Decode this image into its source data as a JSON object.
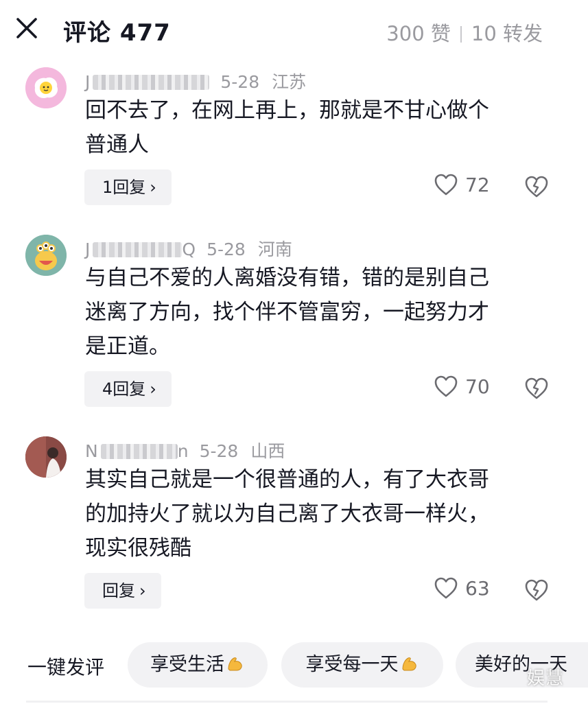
{
  "header": {
    "title": "评论 477",
    "likes": "300 赞",
    "shares": "10 转发"
  },
  "comments": [
    {
      "username_visible": "J",
      "date": "5-28",
      "location": "江苏",
      "text_lines": [
        "回不去了，在网上再上，那就是不甘心做个",
        "普通人"
      ],
      "reply_label": "1回复",
      "like_count": "72",
      "avatar_icon": "fried-egg-avatar"
    },
    {
      "username_visible": "J",
      "username_suffix": "Q",
      "date": "5-28",
      "location": "河南",
      "text_lines": [
        "与自己不爱的人离婚没有错，错的是别自己",
        "迷离了方向，找个伴不管富穷，一起努力才",
        "是正道。"
      ],
      "reply_label": "4回复",
      "like_count": "70",
      "avatar_icon": "monster-avatar"
    },
    {
      "username_visible": "N",
      "username_suffix": "n",
      "date": "5-28",
      "location": "山西",
      "text_lines": [
        "其实自己就是一个很普通的人，有了大衣哥",
        "的加持火了就以为自己离了大衣哥一样火，",
        "现实很残酷"
      ],
      "reply_label": "回复",
      "like_count": "63",
      "avatar_icon": "photo-avatar"
    }
  ],
  "quick_comment": {
    "label": "一键发评",
    "chips": [
      "享受生活",
      "享受每一天",
      "美好的一天"
    ]
  },
  "watermark": "娱慧",
  "colors": {
    "text": "#161823",
    "secondary": "#9a9a9f",
    "chip_bg": "#f2f2f4"
  }
}
